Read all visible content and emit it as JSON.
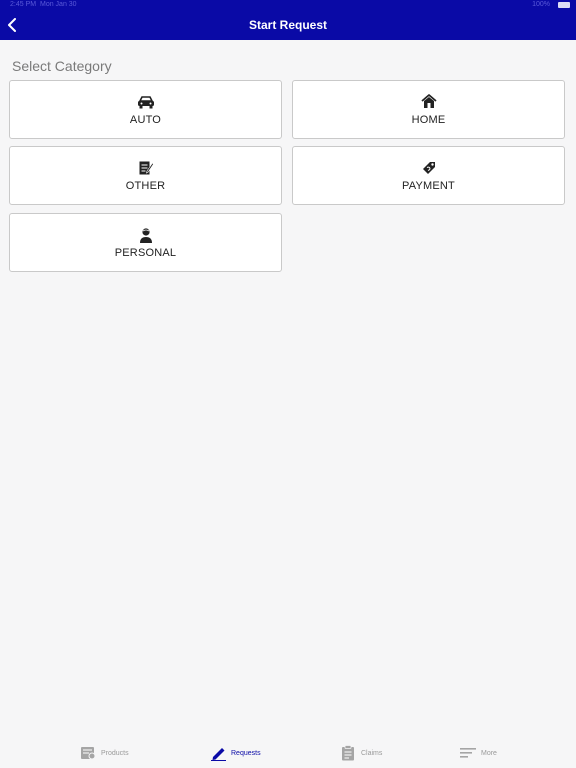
{
  "status_bar": {
    "time": "2:45 PM",
    "carrier": "Mon Jan 30",
    "battery": "100%"
  },
  "header": {
    "title": "Start Request",
    "back_icon": "chevron-left-icon"
  },
  "section_title": "Select Category",
  "categories": [
    {
      "label": "AUTO",
      "icon": "car-icon"
    },
    {
      "label": "HOME",
      "icon": "house-icon"
    },
    {
      "label": "OTHER",
      "icon": "document-edit-icon"
    },
    {
      "label": "PAYMENT",
      "icon": "money-tag-icon"
    },
    {
      "label": "PERSONAL",
      "icon": "person-icon"
    }
  ],
  "tabs": [
    {
      "label": "Products",
      "icon": "products-icon",
      "active": false
    },
    {
      "label": "Requests",
      "icon": "pencil-icon",
      "active": true
    },
    {
      "label": "Claims",
      "icon": "clipboard-icon",
      "active": false
    },
    {
      "label": "More",
      "icon": "menu-lines-icon",
      "active": false
    }
  ],
  "colors": {
    "header": "#0a0aa6",
    "accent": "#0a0aa6",
    "inactive": "#9a9a9a"
  }
}
